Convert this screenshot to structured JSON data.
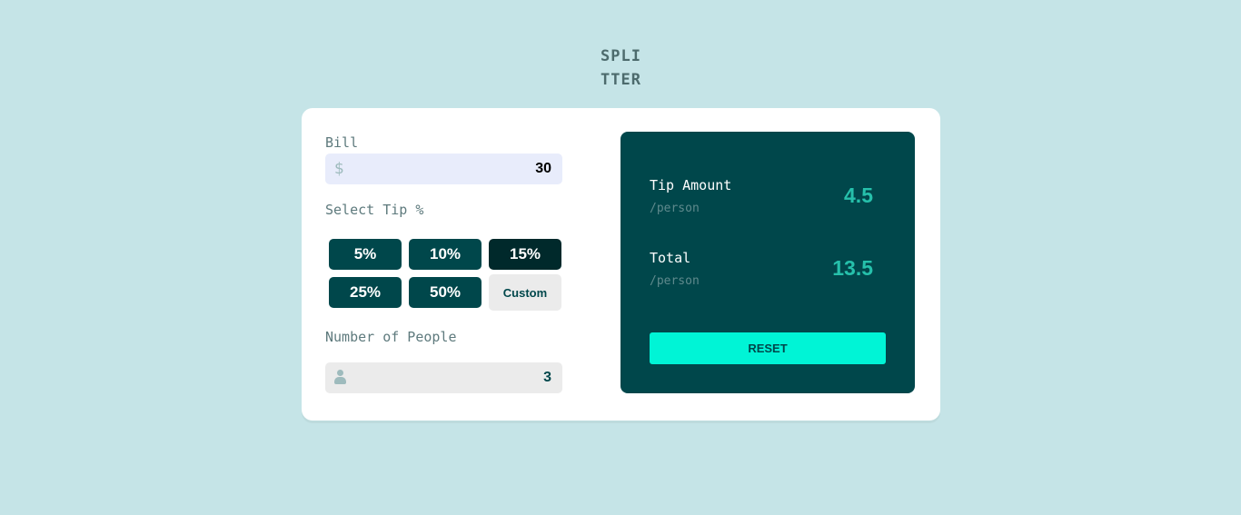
{
  "logo": {
    "line1": "SPLI",
    "line2": "TTER"
  },
  "bill": {
    "label": "Bill",
    "currency_icon": "$",
    "value": "30"
  },
  "tip": {
    "label": "Select Tip %",
    "options": [
      "5%",
      "10%",
      "15%",
      "25%",
      "50%"
    ],
    "selected": "15%",
    "custom_label": "Custom"
  },
  "people": {
    "label": "Number of People",
    "icon": "person-icon",
    "value": "3"
  },
  "results": {
    "tip_amount_label": "Tip Amount",
    "tip_amount_sub": "/person",
    "tip_amount_value": "4.5",
    "total_label": "Total",
    "total_sub": "/person",
    "total_value": "13.5",
    "reset_label": "RESET"
  },
  "colors": {
    "background": "#c5e4e7",
    "dark_cyan": "#00474b",
    "active_tip": "#00292b",
    "accent_value": "#26c0ab",
    "reset_button": "#00f4d6"
  }
}
